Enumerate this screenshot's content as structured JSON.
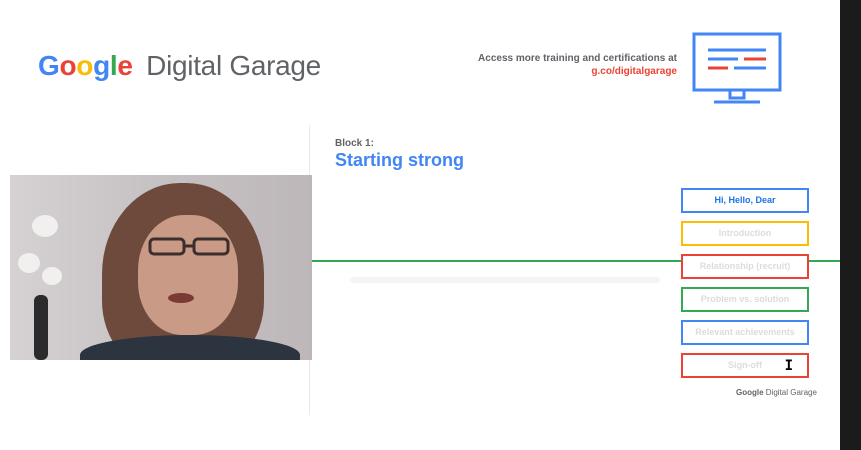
{
  "brand": {
    "logo_letters": [
      {
        "char": "G",
        "color": "#4285f4"
      },
      {
        "char": "o",
        "color": "#ea4335"
      },
      {
        "char": "o",
        "color": "#fbbc04"
      },
      {
        "char": "g",
        "color": "#4285f4"
      },
      {
        "char": "l",
        "color": "#34a853"
      },
      {
        "char": "e",
        "color": "#ea4335"
      }
    ],
    "logo_suffix": "Digital Garage"
  },
  "header": {
    "access_line1": "Access more training and certifications at",
    "access_line2": "g.co/digitalgarage",
    "monitor_icon": "monitor-icon"
  },
  "block": {
    "label": "Block 1:",
    "title": "Starting strong"
  },
  "steps": [
    {
      "label": "Hi, Hello, Dear",
      "color": "blue"
    },
    {
      "label": "Introduction",
      "color": "yellow"
    },
    {
      "label": "Relationship (recruit)",
      "color": "red"
    },
    {
      "label": "Problem vs. solution",
      "color": "green"
    },
    {
      "label": "Relevant achievements",
      "color": "blue"
    },
    {
      "label": "Sign-off",
      "color": "red"
    }
  ],
  "active_step": "Hi, Hello, Dear",
  "cursor_glyph": "I",
  "footer": {
    "google": "Google",
    "suffix": "Digital Garage"
  },
  "colors": {
    "blue": "#4285f4",
    "red": "#ea4335",
    "yellow": "#fbbc04",
    "green": "#34a853"
  }
}
